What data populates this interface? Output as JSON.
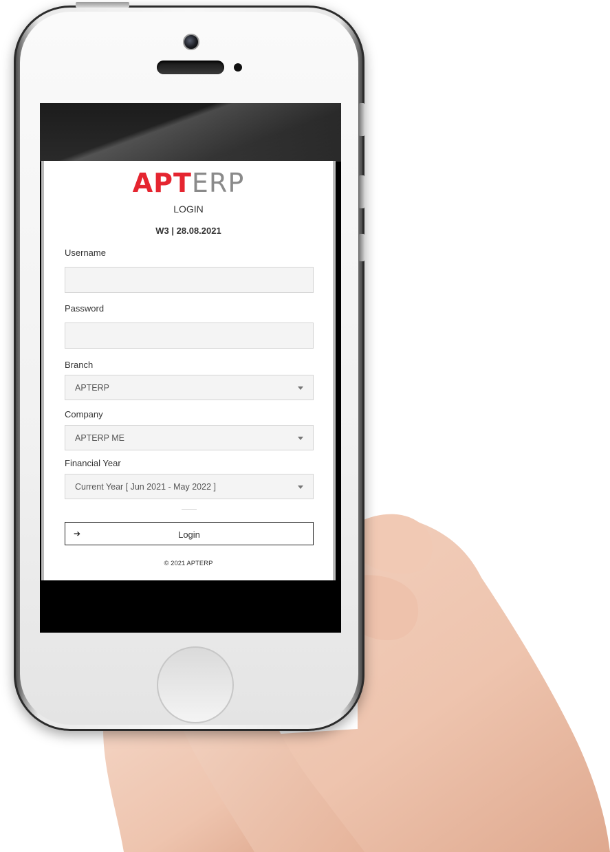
{
  "logo": {
    "red_part": "APT",
    "grey_part": "ERP"
  },
  "header": {
    "title": "LOGIN",
    "subtitle": "W3 | 28.08.2021"
  },
  "form": {
    "username_label": "Username",
    "username_value": "",
    "password_label": "Password",
    "password_value": "",
    "branch_label": "Branch",
    "branch_value": "APTERP",
    "company_label": "Company",
    "company_value": "APTERP ME",
    "financial_year_label": "Financial Year",
    "financial_year_value": "Current Year [ Jun 2021 - May 2022 ]"
  },
  "login_button": {
    "label": "Login",
    "icon": "sign-in-icon"
  },
  "footer": {
    "copyright": "© 2021 APTERP"
  },
  "colors": {
    "brand_red": "#e52530",
    "brand_grey": "#8a8a8a"
  }
}
